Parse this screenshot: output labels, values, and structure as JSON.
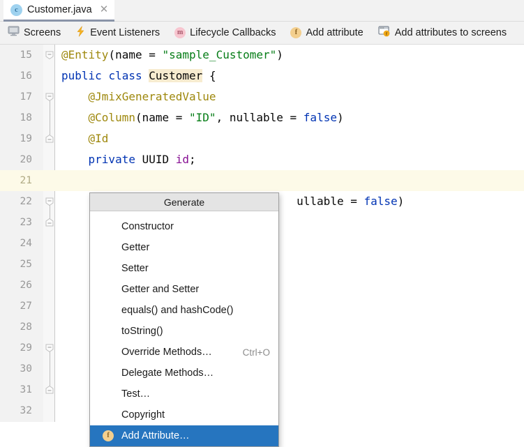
{
  "tab": {
    "icon": "java-class-icon",
    "icon_letter": "c",
    "title": "Customer.java",
    "close_glyph": "✕"
  },
  "toolbar": {
    "items": [
      {
        "icon": "screens-monitor-icon",
        "label": "Screens"
      },
      {
        "icon": "event-listeners-lightning-icon",
        "label": "Event Listeners"
      },
      {
        "icon": "lifecycle-callbacks-method-icon",
        "icon_letter": "m",
        "label": "Lifecycle Callbacks"
      },
      {
        "icon": "add-attribute-field-icon",
        "icon_letter": "f",
        "label": "Add attribute"
      },
      {
        "icon": "add-attributes-to-screens-icon",
        "icon_letter": "f",
        "label": "Add attributes to screens"
      }
    ]
  },
  "editor": {
    "caret_line": 21,
    "lines": [
      {
        "number": "15",
        "fold": "collapse-start",
        "tokens": [
          {
            "t": "@Entity",
            "c": "anno"
          },
          {
            "t": "(name = ",
            "c": "plain"
          },
          {
            "t": "\"sample_Customer\"",
            "c": "str"
          },
          {
            "t": ")",
            "c": "plain"
          }
        ]
      },
      {
        "number": "16",
        "fold": "none",
        "tokens": [
          {
            "t": "public",
            "c": "kw"
          },
          {
            "t": " ",
            "c": "plain"
          },
          {
            "t": "class",
            "c": "kw"
          },
          {
            "t": " ",
            "c": "plain"
          },
          {
            "t": "Customer",
            "c": "hl"
          },
          {
            "t": " {",
            "c": "plain"
          }
        ]
      },
      {
        "number": "17",
        "fold": "collapse-start",
        "tokens": [
          {
            "t": "    ",
            "c": "plain"
          },
          {
            "t": "@JmixGeneratedValue",
            "c": "anno"
          }
        ]
      },
      {
        "number": "18",
        "fold": "none",
        "tokens": [
          {
            "t": "    ",
            "c": "plain"
          },
          {
            "t": "@Column",
            "c": "anno"
          },
          {
            "t": "(name = ",
            "c": "plain"
          },
          {
            "t": "\"ID\"",
            "c": "str"
          },
          {
            "t": ", nullable = ",
            "c": "plain"
          },
          {
            "t": "false",
            "c": "kw"
          },
          {
            "t": ")",
            "c": "plain"
          }
        ]
      },
      {
        "number": "19",
        "fold": "collapse-end",
        "tokens": [
          {
            "t": "    ",
            "c": "plain"
          },
          {
            "t": "@Id",
            "c": "anno"
          }
        ]
      },
      {
        "number": "20",
        "fold": "none",
        "tokens": [
          {
            "t": "    ",
            "c": "plain"
          },
          {
            "t": "private",
            "c": "kw"
          },
          {
            "t": " UUID ",
            "c": "plain"
          },
          {
            "t": "id",
            "c": "field"
          },
          {
            "t": ";",
            "c": "plain"
          }
        ]
      },
      {
        "number": "21",
        "fold": "none",
        "tokens": []
      },
      {
        "number": "22",
        "fold": "collapse-start",
        "tokens": [
          {
            "t": "                                   ullable = ",
            "c": "plain"
          },
          {
            "t": "false",
            "c": "kw"
          },
          {
            "t": ")",
            "c": "plain"
          }
        ]
      },
      {
        "number": "23",
        "fold": "collapse-end",
        "tokens": []
      },
      {
        "number": "24",
        "fold": "none",
        "tokens": []
      },
      {
        "number": "25",
        "fold": "none",
        "tokens": []
      },
      {
        "number": "26",
        "fold": "none",
        "tokens": []
      },
      {
        "number": "27",
        "fold": "none",
        "tokens": []
      },
      {
        "number": "28",
        "fold": "none",
        "tokens": []
      },
      {
        "number": "29",
        "fold": "collapse-start",
        "tokens": [
          {
            "t": "                           {",
            "c": "plain"
          }
        ]
      },
      {
        "number": "30",
        "fold": "none",
        "tokens": []
      },
      {
        "number": "31",
        "fold": "collapse-end",
        "tokens": []
      },
      {
        "number": "32",
        "fold": "none",
        "tokens": []
      }
    ]
  },
  "popup": {
    "title": "Generate",
    "items": [
      {
        "label": "Constructor",
        "shortcut": "",
        "icon": "",
        "selected": false
      },
      {
        "label": "Getter",
        "shortcut": "",
        "icon": "",
        "selected": false
      },
      {
        "label": "Setter",
        "shortcut": "",
        "icon": "",
        "selected": false
      },
      {
        "label": "Getter and Setter",
        "shortcut": "",
        "icon": "",
        "selected": false
      },
      {
        "label": "equals() and hashCode()",
        "shortcut": "",
        "icon": "",
        "selected": false
      },
      {
        "label": "toString()",
        "shortcut": "",
        "icon": "",
        "selected": false
      },
      {
        "label": "Override Methods…",
        "shortcut": "Ctrl+O",
        "icon": "",
        "selected": false
      },
      {
        "label": "Delegate Methods…",
        "shortcut": "",
        "icon": "",
        "selected": false
      },
      {
        "label": "Test…",
        "shortcut": "",
        "icon": "",
        "selected": false
      },
      {
        "label": "Copyright",
        "shortcut": "",
        "icon": "",
        "selected": false
      },
      {
        "label": "Add Attribute…",
        "shortcut": "",
        "icon": "add-attribute-field-icon",
        "icon_letter": "f",
        "selected": true
      }
    ]
  },
  "colors": {
    "annotation": "#9e880d",
    "keyword": "#0033b3",
    "string": "#067d17",
    "field": "#871094",
    "selection": "#2675bf",
    "caret_line": "#fdfae8",
    "identifier_highlight": "#f7ecd0"
  }
}
